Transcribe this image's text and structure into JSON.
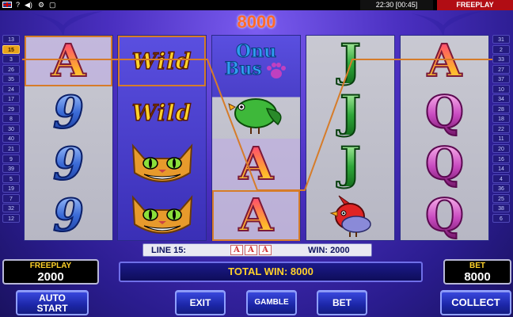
{
  "topbar": {
    "help_icon": "question-icon",
    "sound_icon": "speaker-icon",
    "settings_icon": "gear-icon",
    "clock": "22:30 [00:45]",
    "mode": "FREEPLAY"
  },
  "top_win": "8000",
  "lines_left": [
    "13",
    "15",
    "3",
    "26",
    "35",
    "24",
    "17",
    "29",
    "8",
    "30",
    "40",
    "21",
    "9",
    "39",
    "5",
    "19",
    "7",
    "32",
    "12"
  ],
  "lines_right": [
    "31",
    "2",
    "33",
    "27",
    "37",
    "10",
    "34",
    "28",
    "18",
    "22",
    "11",
    "20",
    "16",
    "14",
    "4",
    "36",
    "25",
    "38",
    "6"
  ],
  "active_line": "15",
  "reels": [
    [
      "A",
      "9",
      "9",
      "9"
    ],
    [
      "Wild",
      "Wild",
      "cat",
      "cat"
    ],
    [
      "onubus",
      "bird-green",
      "A",
      "A"
    ],
    [
      "J",
      "J",
      "J",
      "bird-red"
    ],
    [
      "A",
      "Q",
      "Q",
      "Q"
    ]
  ],
  "symbols": {
    "wild_text": "Wild",
    "onubus_top": "Onu",
    "onubus_bottom": "Bus"
  },
  "info": {
    "line_label": "LINE 15:",
    "mini_symbols": [
      "A",
      "A",
      "A"
    ],
    "win_label": "WIN: 2000"
  },
  "credit": {
    "label": "FREEPLAY",
    "value": "2000"
  },
  "bet": {
    "label": "BET",
    "value": "8000"
  },
  "total_win": "TOTAL WIN: 8000",
  "buttons": {
    "autostart_line1": "AUTO",
    "autostart_line2": "START",
    "exit": "EXIT",
    "gamble": "GAMBLE",
    "bet": "BET",
    "collect": "COLLECT"
  },
  "colors": {
    "accent": "#ffd22a",
    "payline": "#d67c2a",
    "top_win": "#ff6a2a",
    "freeplay_tag": "#b10d14"
  }
}
